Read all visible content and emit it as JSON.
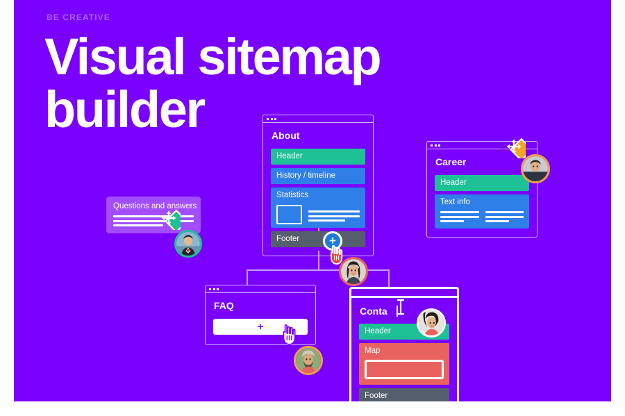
{
  "theme": {
    "background": "#7a00ff",
    "page_margin": "#ffffff",
    "eyebrow_color": "#a964f7",
    "line_color": "#c79dfb",
    "teal": "#1ec196",
    "blue": "#2f7fe8",
    "gray": "#555e6d",
    "coral": "#e8635f",
    "fab_blue": "#1f7ae0",
    "move_orange": "#f5a623",
    "move_teal": "#1ec196",
    "hand_red": "#e8453c"
  },
  "header": {
    "eyebrow": "BE CREATIVE",
    "title": "Visual sitemap builder"
  },
  "cards": {
    "about": {
      "title": "About",
      "blocks": [
        {
          "label": "Header",
          "color": "#1ec196",
          "kind": "plain"
        },
        {
          "label": "History / timeline",
          "color": "#2f7fe8",
          "kind": "plain"
        },
        {
          "label": "Statistics",
          "color": "#2f7fe8",
          "kind": "stats"
        },
        {
          "label": "Footer",
          "color": "#555e6d",
          "kind": "plain"
        }
      ]
    },
    "career": {
      "title": "Career",
      "blocks": [
        {
          "label": "Header",
          "color": "#1ec196",
          "kind": "plain"
        },
        {
          "label": "Text info",
          "color": "#2f7fe8",
          "kind": "twocol"
        }
      ]
    },
    "faq": {
      "title": "FAQ",
      "add_label": "+"
    },
    "contact": {
      "title": "Conta",
      "editing": true,
      "blocks": [
        {
          "label": "Header",
          "color": "#1ec196",
          "kind": "plain"
        },
        {
          "label": "Map",
          "color": "#e8635f",
          "kind": "map"
        },
        {
          "label": "Footer",
          "color": "#555e6d",
          "kind": "plain"
        }
      ]
    },
    "dragged": {
      "title": "Questions and answers"
    }
  },
  "controls": {
    "add_node_label": "+",
    "move_cursor_career": "move-cursor-icon",
    "move_cursor_dragged": "move-cursor-icon",
    "hand_cursor_faq": "hand-pointer-icon",
    "hand_cursor_add": "hand-pointer-icon",
    "text_cursor_contact": "i-beam-cursor-icon"
  },
  "collaborators": [
    {
      "name": "collaborator-dragging",
      "ring": "#1ec196"
    },
    {
      "name": "collaborator-career",
      "ring": "#f0a14a"
    },
    {
      "name": "collaborator-add-node",
      "ring": "#e8635f"
    },
    {
      "name": "collaborator-faq",
      "ring": "#f0a14a"
    },
    {
      "name": "collaborator-contact",
      "ring": "#ffffff"
    }
  ]
}
